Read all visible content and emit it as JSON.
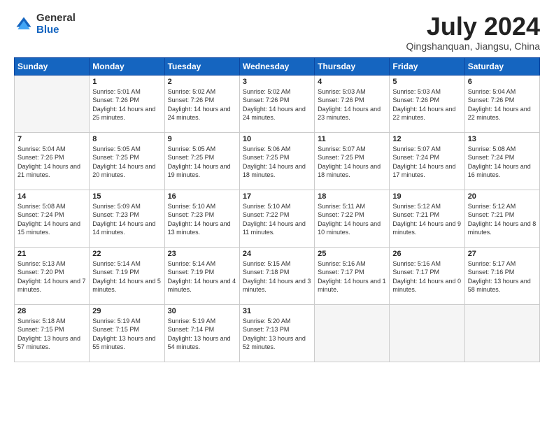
{
  "logo": {
    "general": "General",
    "blue": "Blue"
  },
  "header": {
    "month_year": "July 2024",
    "location": "Qingshanquan, Jiangsu, China"
  },
  "weekdays": [
    "Sunday",
    "Monday",
    "Tuesday",
    "Wednesday",
    "Thursday",
    "Friday",
    "Saturday"
  ],
  "weeks": [
    [
      {
        "day": null
      },
      {
        "day": "1",
        "sunrise": "5:01 AM",
        "sunset": "7:26 PM",
        "daylight": "14 hours and 25 minutes."
      },
      {
        "day": "2",
        "sunrise": "5:02 AM",
        "sunset": "7:26 PM",
        "daylight": "14 hours and 24 minutes."
      },
      {
        "day": "3",
        "sunrise": "5:02 AM",
        "sunset": "7:26 PM",
        "daylight": "14 hours and 24 minutes."
      },
      {
        "day": "4",
        "sunrise": "5:03 AM",
        "sunset": "7:26 PM",
        "daylight": "14 hours and 23 minutes."
      },
      {
        "day": "5",
        "sunrise": "5:03 AM",
        "sunset": "7:26 PM",
        "daylight": "14 hours and 22 minutes."
      },
      {
        "day": "6",
        "sunrise": "5:04 AM",
        "sunset": "7:26 PM",
        "daylight": "14 hours and 22 minutes."
      }
    ],
    [
      {
        "day": "7",
        "sunrise": "5:04 AM",
        "sunset": "7:26 PM",
        "daylight": "14 hours and 21 minutes."
      },
      {
        "day": "8",
        "sunrise": "5:05 AM",
        "sunset": "7:25 PM",
        "daylight": "14 hours and 20 minutes."
      },
      {
        "day": "9",
        "sunrise": "5:05 AM",
        "sunset": "7:25 PM",
        "daylight": "14 hours and 19 minutes."
      },
      {
        "day": "10",
        "sunrise": "5:06 AM",
        "sunset": "7:25 PM",
        "daylight": "14 hours and 18 minutes."
      },
      {
        "day": "11",
        "sunrise": "5:07 AM",
        "sunset": "7:25 PM",
        "daylight": "14 hours and 18 minutes."
      },
      {
        "day": "12",
        "sunrise": "5:07 AM",
        "sunset": "7:24 PM",
        "daylight": "14 hours and 17 minutes."
      },
      {
        "day": "13",
        "sunrise": "5:08 AM",
        "sunset": "7:24 PM",
        "daylight": "14 hours and 16 minutes."
      }
    ],
    [
      {
        "day": "14",
        "sunrise": "5:08 AM",
        "sunset": "7:24 PM",
        "daylight": "14 hours and 15 minutes."
      },
      {
        "day": "15",
        "sunrise": "5:09 AM",
        "sunset": "7:23 PM",
        "daylight": "14 hours and 14 minutes."
      },
      {
        "day": "16",
        "sunrise": "5:10 AM",
        "sunset": "7:23 PM",
        "daylight": "14 hours and 13 minutes."
      },
      {
        "day": "17",
        "sunrise": "5:10 AM",
        "sunset": "7:22 PM",
        "daylight": "14 hours and 11 minutes."
      },
      {
        "day": "18",
        "sunrise": "5:11 AM",
        "sunset": "7:22 PM",
        "daylight": "14 hours and 10 minutes."
      },
      {
        "day": "19",
        "sunrise": "5:12 AM",
        "sunset": "7:21 PM",
        "daylight": "14 hours and 9 minutes."
      },
      {
        "day": "20",
        "sunrise": "5:12 AM",
        "sunset": "7:21 PM",
        "daylight": "14 hours and 8 minutes."
      }
    ],
    [
      {
        "day": "21",
        "sunrise": "5:13 AM",
        "sunset": "7:20 PM",
        "daylight": "14 hours and 7 minutes."
      },
      {
        "day": "22",
        "sunrise": "5:14 AM",
        "sunset": "7:19 PM",
        "daylight": "14 hours and 5 minutes."
      },
      {
        "day": "23",
        "sunrise": "5:14 AM",
        "sunset": "7:19 PM",
        "daylight": "14 hours and 4 minutes."
      },
      {
        "day": "24",
        "sunrise": "5:15 AM",
        "sunset": "7:18 PM",
        "daylight": "14 hours and 3 minutes."
      },
      {
        "day": "25",
        "sunrise": "5:16 AM",
        "sunset": "7:17 PM",
        "daylight": "14 hours and 1 minute."
      },
      {
        "day": "26",
        "sunrise": "5:16 AM",
        "sunset": "7:17 PM",
        "daylight": "14 hours and 0 minutes."
      },
      {
        "day": "27",
        "sunrise": "5:17 AM",
        "sunset": "7:16 PM",
        "daylight": "13 hours and 58 minutes."
      }
    ],
    [
      {
        "day": "28",
        "sunrise": "5:18 AM",
        "sunset": "7:15 PM",
        "daylight": "13 hours and 57 minutes."
      },
      {
        "day": "29",
        "sunrise": "5:19 AM",
        "sunset": "7:15 PM",
        "daylight": "13 hours and 55 minutes."
      },
      {
        "day": "30",
        "sunrise": "5:19 AM",
        "sunset": "7:14 PM",
        "daylight": "13 hours and 54 minutes."
      },
      {
        "day": "31",
        "sunrise": "5:20 AM",
        "sunset": "7:13 PM",
        "daylight": "13 hours and 52 minutes."
      },
      {
        "day": null
      },
      {
        "day": null
      },
      {
        "day": null
      }
    ]
  ]
}
